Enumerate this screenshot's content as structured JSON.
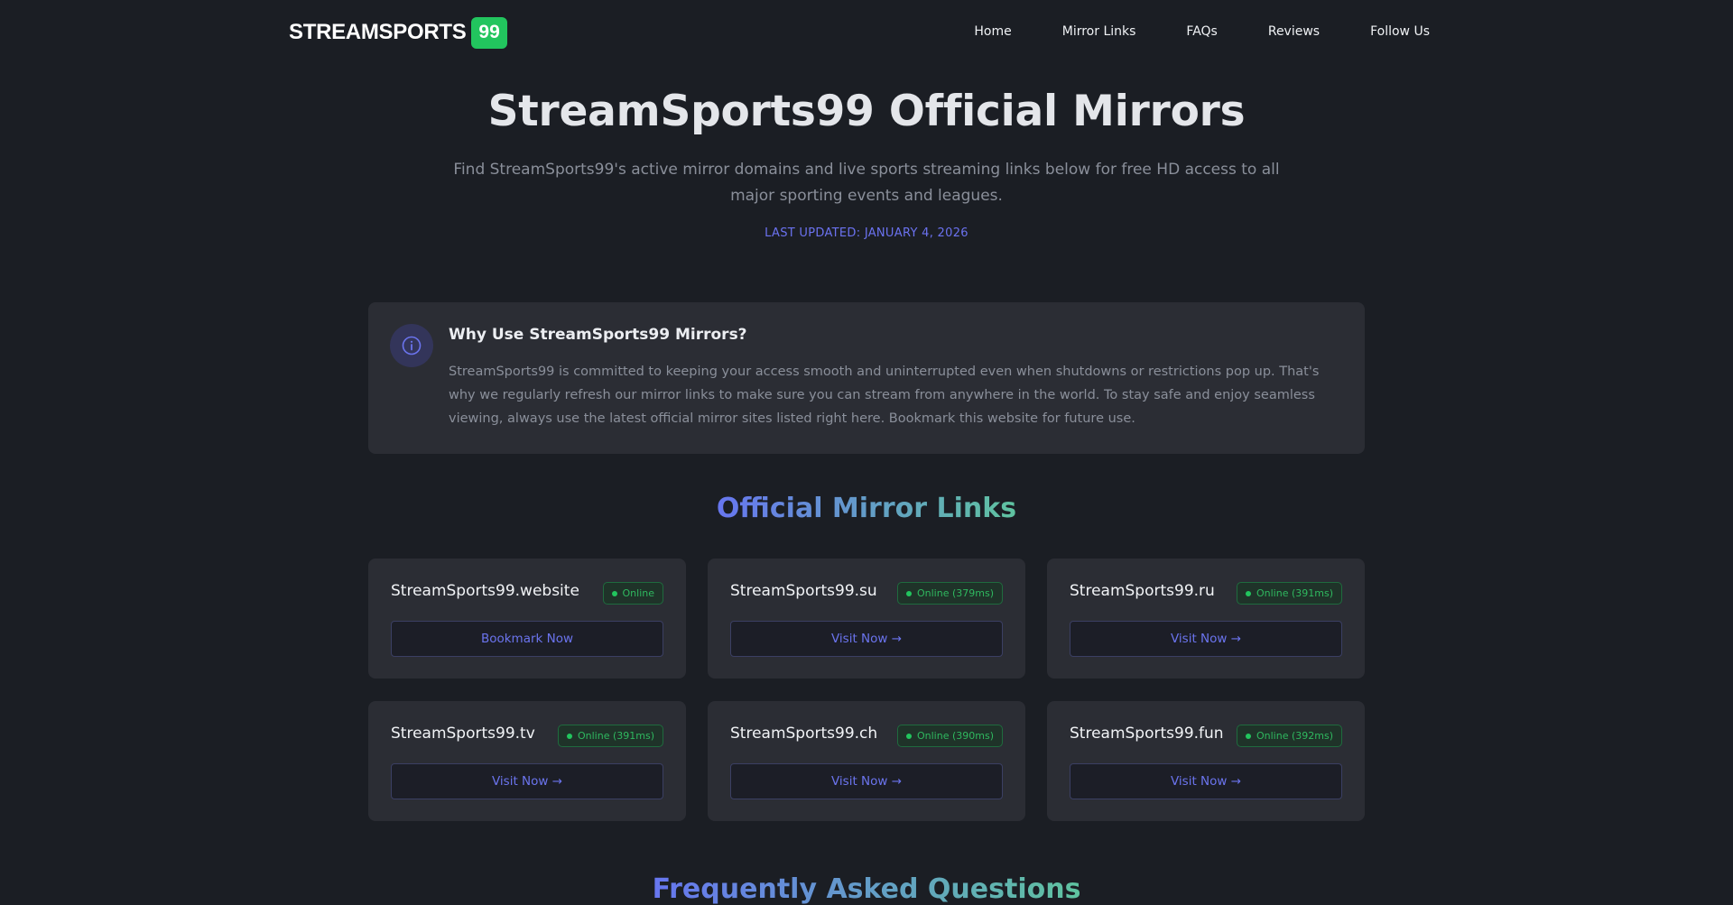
{
  "header": {
    "logo_text": "STREAMSPORTS",
    "logo_badge": "99",
    "nav": [
      "Home",
      "Mirror Links",
      "FAQs",
      "Reviews",
      "Follow Us"
    ]
  },
  "hero": {
    "title": "StreamSports99 Official Mirrors",
    "subtitle": "Find StreamSports99's active mirror domains and live sports streaming links below for free HD access to all major sporting events and leagues.",
    "updated": "LAST UPDATED: JANUARY 4, 2026"
  },
  "info": {
    "icon": "info-icon",
    "title": "Why Use StreamSports99 Mirrors?",
    "text": "StreamSports99 is committed to keeping your access smooth and uninterrupted even when shutdowns or restrictions pop up. That's why we regularly refresh our mirror links to make sure you can stream from anywhere in the world. To stay safe and enjoy seamless viewing, always use the latest official mirror sites listed right here. Bookmark this website for future use."
  },
  "mirrors": {
    "title": "Official Mirror Links",
    "items": [
      {
        "domain": "StreamSports99.website",
        "status": "Online",
        "button": "Bookmark Now"
      },
      {
        "domain": "StreamSports99.su",
        "status": "Online (379ms)",
        "button": "Visit Now →"
      },
      {
        "domain": "StreamSports99.ru",
        "status": "Online (391ms)",
        "button": "Visit Now →"
      },
      {
        "domain": "StreamSports99.tv",
        "status": "Online (391ms)",
        "button": "Visit Now →"
      },
      {
        "domain": "StreamSports99.ch",
        "status": "Online (390ms)",
        "button": "Visit Now →"
      },
      {
        "domain": "StreamSports99.fun",
        "status": "Online (392ms)",
        "button": "Visit Now →"
      }
    ]
  },
  "faq": {
    "title": "Frequently Asked Questions"
  },
  "colors": {
    "background": "#1b1e24",
    "card": "#2b2d34",
    "accent": "#6b74ee",
    "online_green": "#22c55e",
    "logo_badge": "#22c55e"
  }
}
